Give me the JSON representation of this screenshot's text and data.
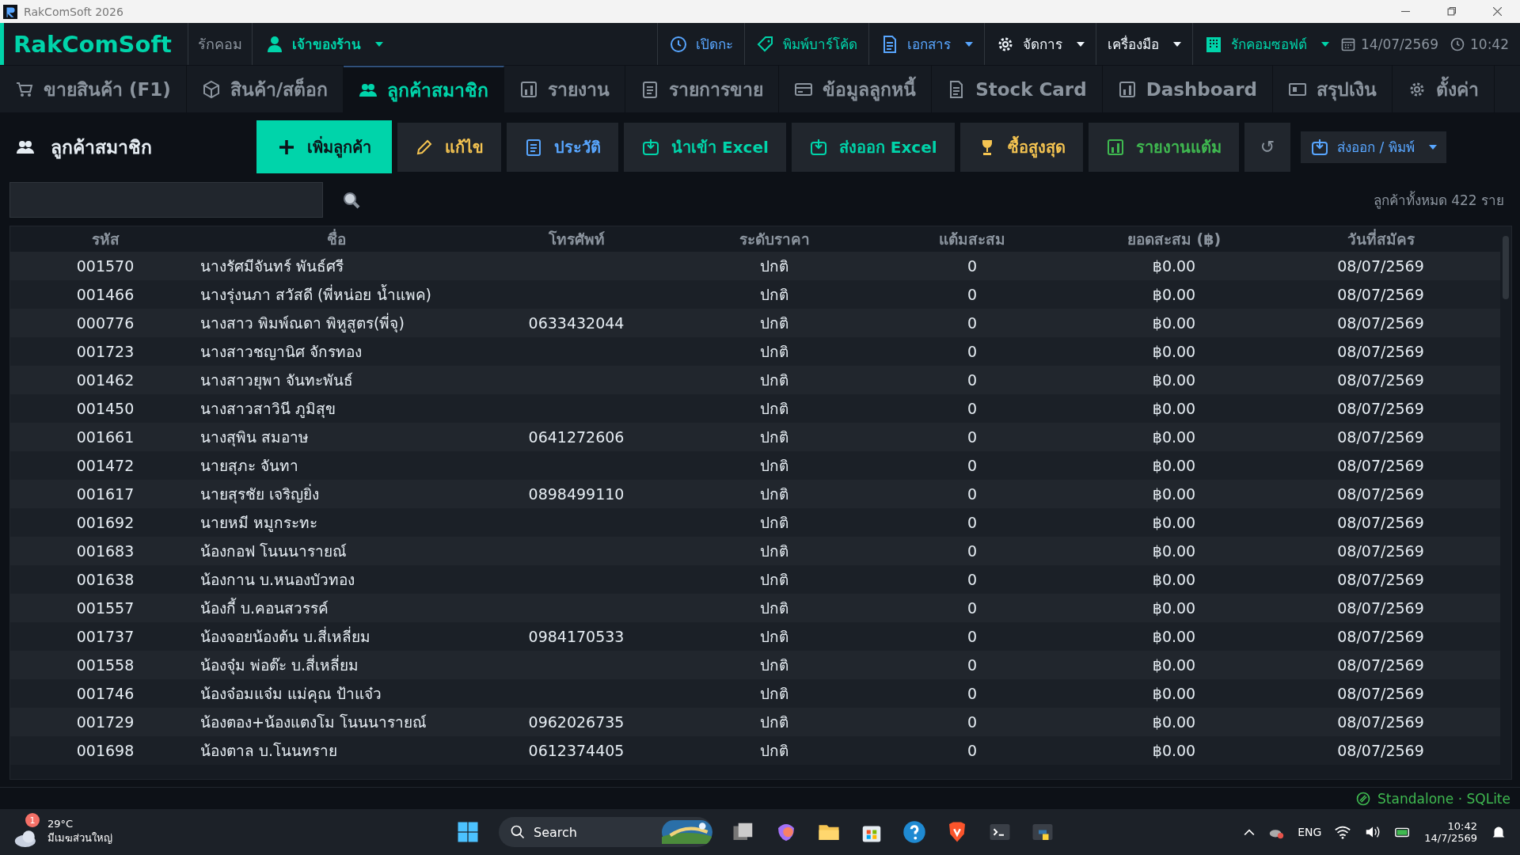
{
  "window": {
    "title": "RakComSoft 2026"
  },
  "topbar": {
    "brand": "RakComSoft",
    "shop": "รักคอม",
    "user": "เจ้าของร้าน",
    "menus": [
      {
        "kind": "clock",
        "label": "เปิดกะ",
        "dropdown": false
      },
      {
        "kind": "tag",
        "label": "พิมพ์บาร์โค้ด",
        "dropdown": false
      },
      {
        "kind": "doc",
        "label": "เอกสาร",
        "dropdown": true
      },
      {
        "kind": "gear",
        "label": "จัดการ",
        "dropdown": true
      },
      {
        "kind": "none",
        "label": "เครื่องมือ",
        "dropdown": true
      },
      {
        "kind": "building",
        "label": "รักคอมซอฟต์",
        "dropdown": true
      }
    ],
    "date": "14/07/2569",
    "time": "10:42"
  },
  "tabs": [
    {
      "kind": "cart",
      "label": "ขายสินค้า (F1)",
      "selected": false
    },
    {
      "kind": "box",
      "label": "สินค้า/สต็อก",
      "selected": false
    },
    {
      "kind": "users",
      "label": "ลูกค้าสมาชิก",
      "selected": true
    },
    {
      "kind": "chart",
      "label": "รายงาน",
      "selected": false
    },
    {
      "kind": "clipboard",
      "label": "รายการขาย",
      "selected": false
    },
    {
      "kind": "card",
      "label": "ข้อมูลลูกหนี้",
      "selected": false
    },
    {
      "kind": "doc",
      "label": "Stock Card",
      "selected": false
    },
    {
      "kind": "chart",
      "label": "Dashboard",
      "selected": false
    },
    {
      "kind": "money",
      "label": "สรุปเงิน",
      "selected": false
    },
    {
      "kind": "gear",
      "label": "ตั้งค่า",
      "selected": false
    }
  ],
  "page": {
    "title": "ลูกค้าสมาชิก",
    "total": "ลูกค้าทั้งหมด 422 ราย"
  },
  "actions": [
    {
      "kind": "primary",
      "label": "เพิ่มลูกค้า",
      "color": "#00d4aa"
    },
    {
      "kind": "plain",
      "label": "แก้ไข",
      "color": "#f5c451"
    },
    {
      "kind": "plain",
      "label": "ประวัติ",
      "color": "#58a6ff"
    },
    {
      "kind": "plain",
      "label": "นำเข้า Excel",
      "color": "#00d4aa"
    },
    {
      "kind": "plain",
      "label": "ส่งออก Excel",
      "color": "#00d4aa"
    },
    {
      "kind": "plain",
      "label": "ซื้อสูงสุด",
      "color": "#f5c451"
    },
    {
      "kind": "plain",
      "label": "รายงานแต้ม",
      "color": "#3fb950"
    },
    {
      "kind": "refresh",
      "label": "↺",
      "color": "#8b949e"
    },
    {
      "kind": "dropdown",
      "label": "ส่งออก / พิมพ์",
      "color": "#58a6ff"
    }
  ],
  "table": {
    "columns": [
      "รหัส",
      "ชื่อ",
      "โทรศัพท์",
      "ระดับราคา",
      "แต้มสะสม",
      "ยอดสะสม (฿)",
      "วันที่สมัคร"
    ],
    "rows": [
      [
        "001570",
        "นางรัศมีจันทร์ พันธ์ศรี",
        "",
        "ปกติ",
        "0",
        "฿0.00",
        "08/07/2569"
      ],
      [
        "001466",
        "นางรุ่งนภา สวัสดี  (พี่หน่อย  น้ำแพค)",
        "",
        "ปกติ",
        "0",
        "฿0.00",
        "08/07/2569"
      ],
      [
        "000776",
        "นางสาว พิมพ์ณดา พิหูสูตร(พี่จุ)",
        "0633432044",
        "ปกติ",
        "0",
        "฿0.00",
        "08/07/2569"
      ],
      [
        "001723",
        "นางสาวชญานิศ จักรทอง",
        "",
        "ปกติ",
        "0",
        "฿0.00",
        "08/07/2569"
      ],
      [
        "001462",
        "นางสาวยุพา จันทะพันธ์",
        "",
        "ปกติ",
        "0",
        "฿0.00",
        "08/07/2569"
      ],
      [
        "001450",
        "นางสาวสาวินี ภูมิสุข",
        "",
        "ปกติ",
        "0",
        "฿0.00",
        "08/07/2569"
      ],
      [
        "001661",
        "นางสุพิน สมอาษ",
        "0641272606",
        "ปกติ",
        "0",
        "฿0.00",
        "08/07/2569"
      ],
      [
        "001472",
        "นายสุภะ จันทา",
        "",
        "ปกติ",
        "0",
        "฿0.00",
        "08/07/2569"
      ],
      [
        "001617",
        "นายสุรชัย เจริญยิ่ง",
        "0898499110",
        "ปกติ",
        "0",
        "฿0.00",
        "08/07/2569"
      ],
      [
        "001692",
        "นายหมี หมูกระทะ",
        "",
        "ปกติ",
        "0",
        "฿0.00",
        "08/07/2569"
      ],
      [
        "001683",
        "น้องกอฟ โนนนารายณ์",
        "",
        "ปกติ",
        "0",
        "฿0.00",
        "08/07/2569"
      ],
      [
        "001638",
        "น้องกาน บ.หนองบัวทอง",
        "",
        "ปกติ",
        "0",
        "฿0.00",
        "08/07/2569"
      ],
      [
        "001557",
        "น้องกี้ บ.คอนสวรรค์",
        "",
        "ปกติ",
        "0",
        "฿0.00",
        "08/07/2569"
      ],
      [
        "001737",
        "น้องจอยน้องต้น บ.สี่เหลี่ยม",
        "0984170533",
        "ปกติ",
        "0",
        "฿0.00",
        "08/07/2569"
      ],
      [
        "001558",
        "น้องจุ๋ม พ่อต๊ะ บ.สี่เหลี่ยม",
        "",
        "ปกติ",
        "0",
        "฿0.00",
        "08/07/2569"
      ],
      [
        "001746",
        "น้องจ๋อมแจ๋ม แม่คุณ ป้าแจ๋ว",
        "",
        "ปกติ",
        "0",
        "฿0.00",
        "08/07/2569"
      ],
      [
        "001729",
        "น้องตอง+น้องแตงโม  โนนนารายณ์",
        "0962026735",
        "ปกติ",
        "0",
        "฿0.00",
        "08/07/2569"
      ],
      [
        "001698",
        "น้องตาล บ.โนนทราย",
        "0612374405",
        "ปกติ",
        "0",
        "฿0.00",
        "08/07/2569"
      ]
    ]
  },
  "status_bar": {
    "mode": "Standalone · SQLite"
  },
  "taskbar": {
    "weather_badge": "1",
    "temperature": "29°C",
    "weather": "มีเมฆส่วนใหญ่",
    "search": "Search",
    "language": "ENG",
    "time": "10:42",
    "date": "14/7/2569"
  }
}
